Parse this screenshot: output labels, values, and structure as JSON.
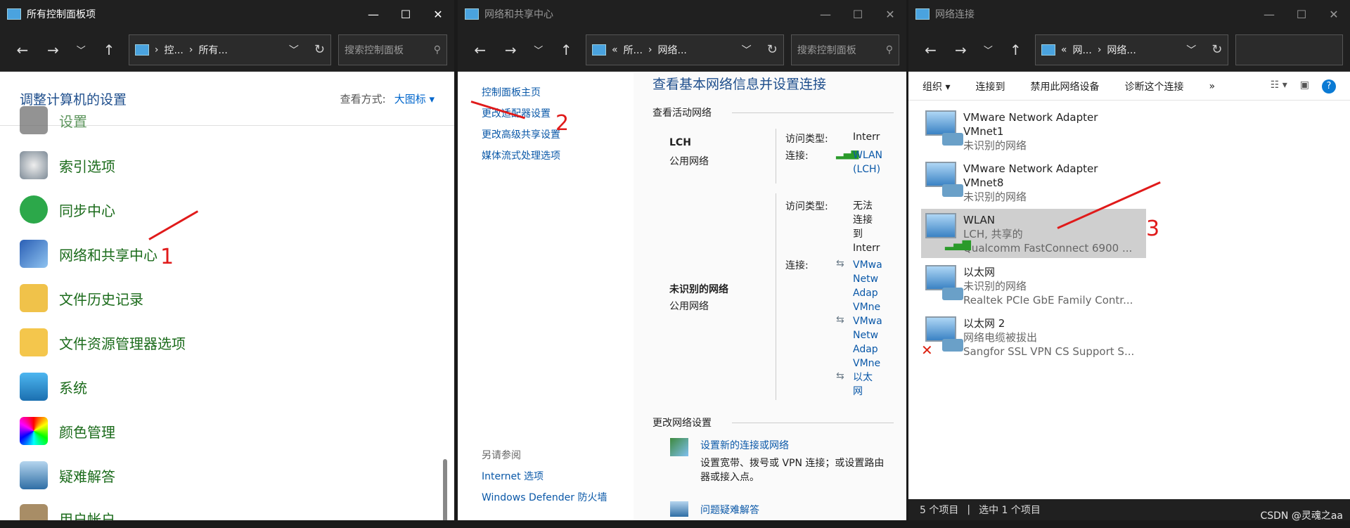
{
  "w1": {
    "title": "所有控制面板项",
    "addr": [
      "控...",
      "所有..."
    ],
    "search": "搜索控制面板",
    "heading": "调整计算机的设置",
    "view_label": "查看方式:",
    "view_value": "大图标 ▾",
    "items": [
      "设置",
      "索引选项",
      "同步中心",
      "网络和共享中心",
      "文件历史记录",
      "文件资源管理器选项",
      "系统",
      "颜色管理",
      "疑难解答",
      "用户帐户"
    ]
  },
  "w2": {
    "title": "网络和共享中心",
    "addr": [
      "所...",
      "网络..."
    ],
    "search": "搜索控制面板",
    "left_links": [
      "控制面板主页",
      "更改适配器设置",
      "更改高级共享设置",
      "媒体流式处理选项"
    ],
    "heading": "查看基本网络信息并设置连接",
    "active_title": "查看活动网络",
    "net1_name": "LCH",
    "net1_type": "公用网络",
    "access_label": "访问类型:",
    "conn_label": "连接:",
    "net1_access": "Interr",
    "net1_conn": "WLAN (LCH)",
    "net2_name": "未识别的网络",
    "net2_type": "公用网络",
    "net2_access": [
      "无法",
      "连接",
      "到",
      "Interr"
    ],
    "net2_conn1": [
      "VMwa",
      "Netw",
      "Adap",
      "VMne"
    ],
    "net2_conn2": [
      "VMwa",
      "Netw",
      "Adap",
      "VMne"
    ],
    "net2_conn3": [
      "以太",
      "网"
    ],
    "change_title": "更改网络设置",
    "setup_link": "设置新的连接或网络",
    "setup_desc": "设置宽带、拨号或 VPN 连接；或设置路由器或接入点。",
    "trouble_link": "问题疑难解答",
    "see_also": "另请参阅",
    "see_links": [
      "Internet 选项",
      "Windows Defender 防火墙"
    ]
  },
  "w3": {
    "title": "网络连接",
    "addr": [
      "网...",
      "网络..."
    ],
    "toolbar": [
      "组织 ▾",
      "连接到",
      "禁用此网络设备",
      "诊断这个连接",
      "»"
    ],
    "adapters": [
      {
        "l1": "VMware Network Adapter",
        "l2": "VMnet1",
        "l3": "未识别的网络"
      },
      {
        "l1": "VMware Network Adapter",
        "l2": "VMnet8",
        "l3": "未识别的网络"
      },
      {
        "l1": "WLAN",
        "l2": "LCH, 共享的",
        "l3": "Qualcomm FastConnect 6900 ..."
      },
      {
        "l1": "以太网",
        "l2": "未识别的网络",
        "l3": "Realtek PCIe GbE Family Contr..."
      },
      {
        "l1": "以太网 2",
        "l2": "网络电缆被拔出",
        "l3": "Sangfor SSL VPN CS Support S..."
      }
    ],
    "status_count": "5 个项目",
    "status_sel": "选中 1 个项目"
  },
  "annotations": [
    "1",
    "2",
    "3"
  ],
  "watermark": "CSDN @灵魂之aa"
}
